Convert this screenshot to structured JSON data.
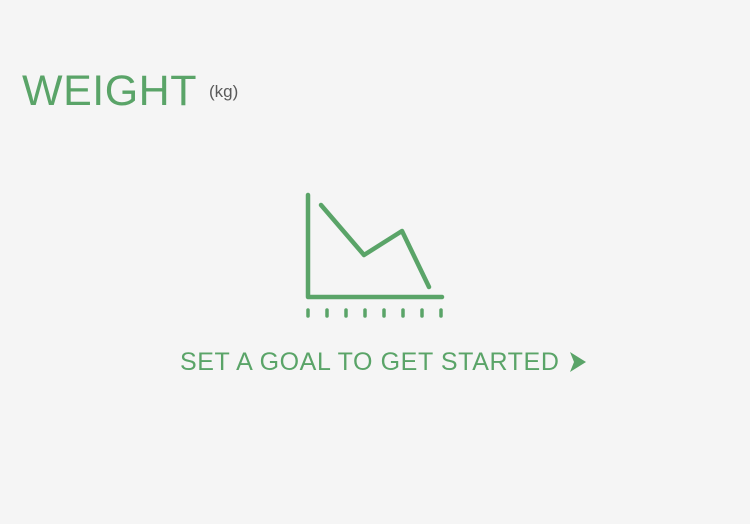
{
  "header": {
    "title": "WEIGHT",
    "unit": "(kg)"
  },
  "empty_state": {
    "icon": "line-chart-icon",
    "cta_label": "SET A GOAL TO GET STARTED",
    "cta_icon": "play-arrow-icon"
  },
  "colors": {
    "accent": "#5aa468",
    "unit_text": "#5a5a5a",
    "background": "#f5f5f5"
  }
}
